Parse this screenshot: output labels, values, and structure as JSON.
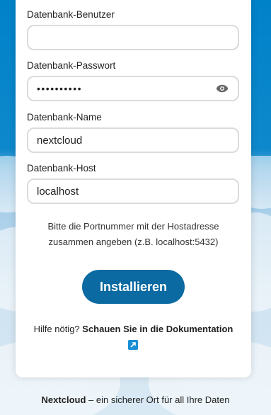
{
  "fields": {
    "db_user": {
      "label": "Datenbank-Benutzer",
      "value": ""
    },
    "db_password": {
      "label": "Datenbank-Passwort",
      "value": "••••••••••"
    },
    "db_name": {
      "label": "Datenbank-Name",
      "value": "nextcloud"
    },
    "db_host": {
      "label": "Datenbank-Host",
      "value": "localhost"
    }
  },
  "hint": {
    "line1": "Bitte die Portnummer mit der Hostadresse",
    "line2": "zusammen angeben (z.B. localhost:5432)"
  },
  "install_button": {
    "label": "Installieren"
  },
  "help": {
    "prefix": "Hilfe nötig?",
    "link_label": "Schauen Sie in die Dokumentation"
  },
  "footer": {
    "brand": "Nextcloud",
    "tagline": "– ein sicherer Ort für all Ihre Daten"
  },
  "icons": {
    "password_toggle": "eye-icon",
    "external_link": "external-link-icon"
  },
  "colors": {
    "primary": "#0a6aa1",
    "background_top": "#0082c9",
    "link_icon": "#1a8fd6"
  }
}
